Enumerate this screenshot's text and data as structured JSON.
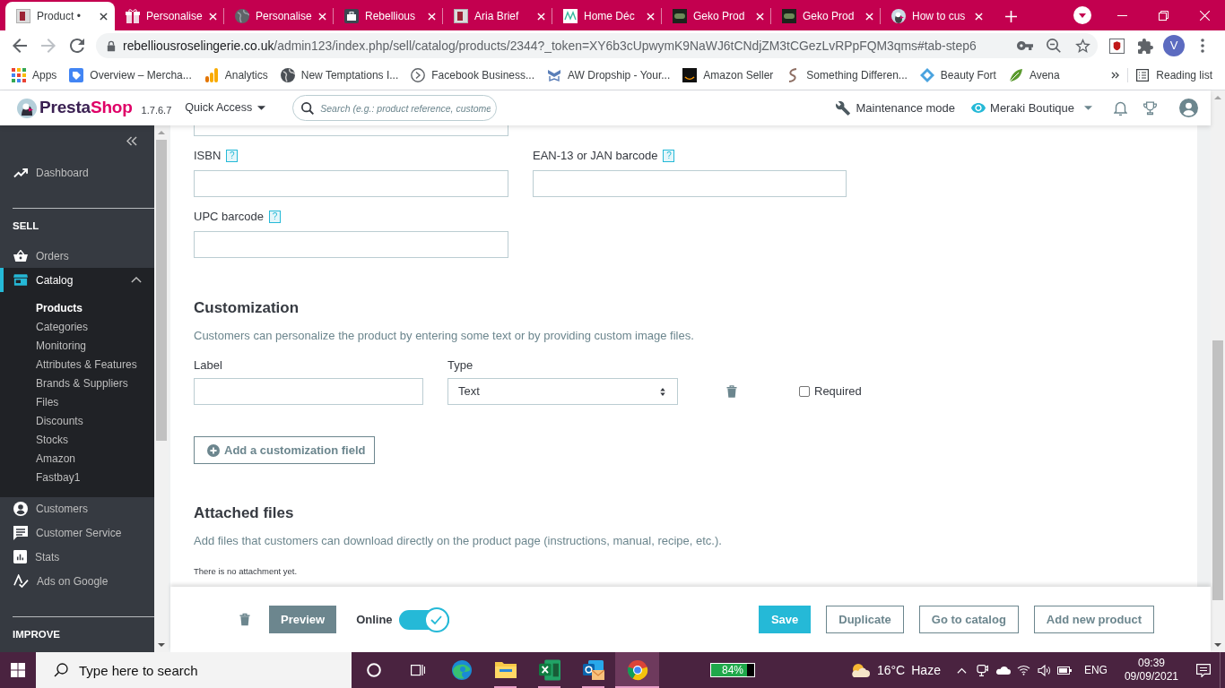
{
  "browser": {
    "tabs": [
      {
        "title": "Product •",
        "selected": true
      },
      {
        "title": "Personalise",
        "selected": false
      },
      {
        "title": "Personalise",
        "selected": false
      },
      {
        "title": "Rebellious",
        "selected": false
      },
      {
        "title": "Aria Brief",
        "selected": false
      },
      {
        "title": "Home Déc",
        "selected": false
      },
      {
        "title": "Geko Prod",
        "selected": false
      },
      {
        "title": "Geko Prod",
        "selected": false
      },
      {
        "title": "How to cus",
        "selected": false
      }
    ],
    "address": {
      "host": "rebelliousroselingerie.co.uk",
      "path": "/admin123/index.php/sell/catalog/products/2344?_token=XY6b3cUpwymK9NaWJ6tCNdjZM3tCGezLvRPpFQM3qms#tab-step6"
    },
    "profile": "V",
    "bookmarks": [
      "Apps",
      "Overview – Mercha...",
      "Analytics",
      "New Temptations I...",
      "Facebook Business...",
      "AW Dropship - Your...",
      "Amazon Seller",
      "Something Differen...",
      "Beauty Fort",
      "Avena"
    ],
    "reading_list": "Reading list"
  },
  "header": {
    "brand": {
      "first": "Presta",
      "second": "Shop"
    },
    "version": "1.7.6.7",
    "quick_access": "Quick Access",
    "search": {
      "placeholder": "Search (e.g.: product reference, custome"
    },
    "maintenance": "Maintenance mode",
    "shop": "Meraki Boutique"
  },
  "sidebar": {
    "items": [
      {
        "kind": "link",
        "label": "Dashboard",
        "selected": false
      },
      {
        "kind": "heading",
        "label": "SELL"
      },
      {
        "kind": "link",
        "label": "Orders",
        "selected": false
      },
      {
        "kind": "link",
        "label": "Catalog",
        "selected": true,
        "expanded": true,
        "children": [
          {
            "label": "Products",
            "selected": true
          },
          {
            "label": "Categories",
            "selected": false
          },
          {
            "label": "Monitoring",
            "selected": false
          },
          {
            "label": "Attributes & Features",
            "selected": false
          },
          {
            "label": "Brands & Suppliers",
            "selected": false
          },
          {
            "label": "Files",
            "selected": false
          },
          {
            "label": "Discounts",
            "selected": false
          },
          {
            "label": "Stocks",
            "selected": false
          },
          {
            "label": "Amazon",
            "selected": false
          },
          {
            "label": "Fastbay1",
            "selected": false
          }
        ]
      },
      {
        "kind": "link",
        "label": "Customers",
        "selected": false
      },
      {
        "kind": "link",
        "label": "Customer Service",
        "selected": false
      },
      {
        "kind": "link",
        "label": "Stats",
        "selected": false
      },
      {
        "kind": "link",
        "label": "Ads on Google",
        "selected": false
      },
      {
        "kind": "heading",
        "label": "IMPROVE"
      }
    ]
  },
  "product_form": {
    "identifiers": [
      {
        "label": "ISBN",
        "help": "?"
      },
      {
        "label": "EAN-13 or JAN barcode",
        "help": "?"
      },
      {
        "label": "UPC barcode",
        "help": "?"
      }
    ],
    "customization": {
      "title": "Customization",
      "description": "Customers can personalize the product by entering some text or by providing custom image files.",
      "label_heading": "Label",
      "type_heading": "Type",
      "fields": [
        {
          "type": "Text",
          "required": {
            "label": "Required",
            "checked": false
          }
        }
      ],
      "add_button": "Add a customization field"
    },
    "attached_files": {
      "title": "Attached files",
      "description": "Add files that customers can download directly on the product page (instructions, manual, recipe, etc.).",
      "empty_note": "There is no attachment yet."
    }
  },
  "footer": {
    "preview": "Preview",
    "online": {
      "label": "Online",
      "on": true
    },
    "buttons": [
      {
        "label": "Save",
        "kind": "primary"
      },
      {
        "label": "Duplicate",
        "kind": "outline"
      },
      {
        "label": "Go to catalog",
        "kind": "outline"
      },
      {
        "label": "Add new product",
        "kind": "outline"
      }
    ]
  },
  "taskbar": {
    "search": {
      "placeholder": "Type here to search"
    },
    "apps": [
      {
        "running": false,
        "selected": false
      },
      {
        "running": false,
        "selected": false
      },
      {
        "running": false,
        "selected": false
      },
      {
        "running": true,
        "selected": false
      },
      {
        "running": true,
        "selected": false
      },
      {
        "running": true,
        "selected": false
      },
      {
        "running": true,
        "selected": true
      }
    ],
    "battery": "84%",
    "weather": {
      "temperature": "16°C",
      "condition": "Haze"
    },
    "language": "ENG",
    "time": "09:39",
    "date": "09/09/2021"
  }
}
